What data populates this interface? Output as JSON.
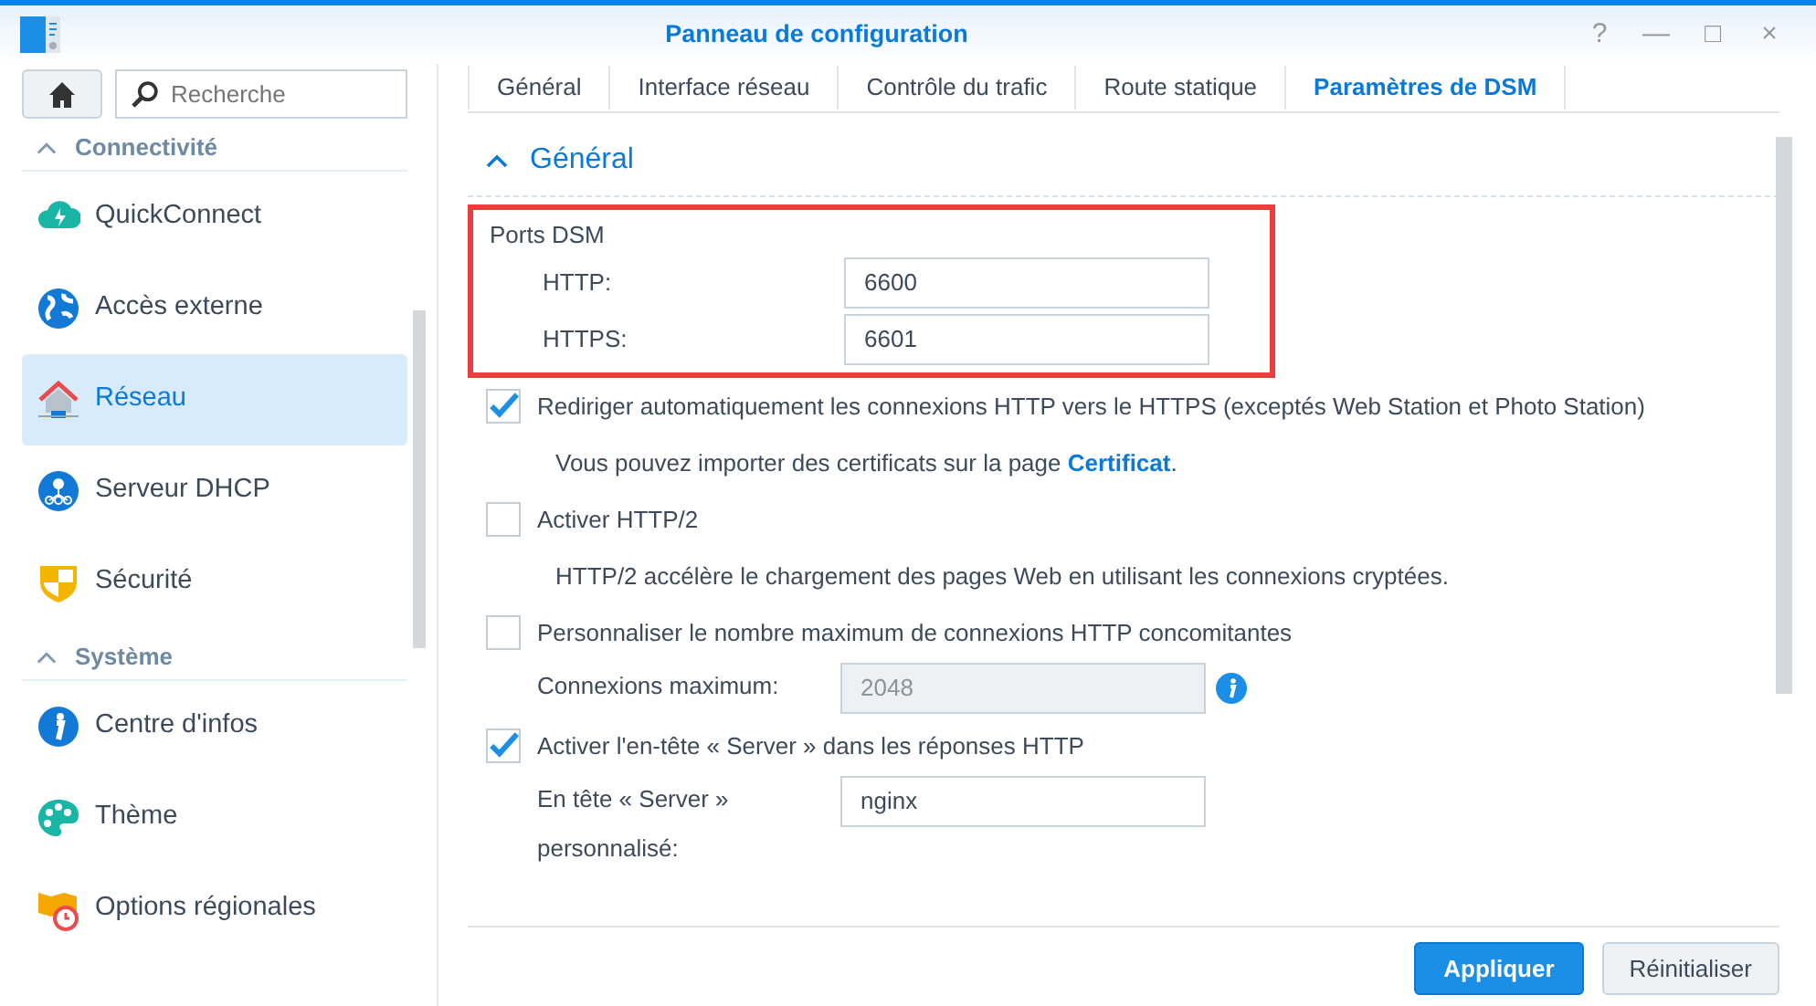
{
  "window": {
    "title": "Panneau de configuration",
    "controls": [
      "?",
      "—",
      "□",
      "×"
    ]
  },
  "sidebar": {
    "search": {
      "placeholder": "Recherche"
    },
    "sections": [
      {
        "title": "Connectivité",
        "expanded": true,
        "items": [
          {
            "label": "QuickConnect",
            "selected": false
          },
          {
            "label": "Accès externe",
            "selected": false
          },
          {
            "label": "Réseau",
            "selected": true
          },
          {
            "label": "Serveur DHCP",
            "selected": false
          },
          {
            "label": "Sécurité",
            "selected": false
          }
        ]
      },
      {
        "title": "Système",
        "expanded": true,
        "items": [
          {
            "label": "Centre d'infos",
            "selected": false
          },
          {
            "label": "Thème",
            "selected": false
          },
          {
            "label": "Options régionales",
            "selected": false
          }
        ]
      }
    ]
  },
  "tabs": [
    {
      "label": "Général",
      "selected": false
    },
    {
      "label": "Interface réseau",
      "selected": false
    },
    {
      "label": "Contrôle du trafic",
      "selected": false
    },
    {
      "label": "Route statique",
      "selected": false
    },
    {
      "label": "Paramètres de DSM",
      "selected": true
    }
  ],
  "section": {
    "title": "Général",
    "expanded": true,
    "ports": {
      "title": "Ports DSM",
      "highlighted": true,
      "fields": [
        {
          "label": "HTTP:",
          "value": "6600"
        },
        {
          "label": "HTTPS:",
          "value": "6601"
        }
      ]
    },
    "rows": [
      {
        "kind": "checkbox",
        "label": "Rediriger automatiquement les connexions HTTP vers le HTTPS (exceptés Web Station et Photo Station)",
        "checked": true
      },
      {
        "kind": "note",
        "text": "Vous pouvez importer des certificats sur la page ",
        "link": "Certificat",
        "after": "."
      },
      {
        "kind": "checkbox",
        "label": "Activer HTTP/2",
        "checked": false
      },
      {
        "kind": "note",
        "text": "HTTP/2 accélère le chargement des pages Web en utilisant les connexions cryptées."
      },
      {
        "kind": "checkbox",
        "label": "Personnaliser le nombre maximum de connexions HTTP concomitantes",
        "checked": false
      },
      {
        "kind": "field",
        "label": "Connexions maximum:",
        "value": "2048",
        "disabled": true,
        "info": true
      },
      {
        "kind": "checkbox",
        "label": "Activer l'en-tête « Server » dans les réponses HTTP",
        "checked": true
      },
      {
        "kind": "field",
        "label": "En tête « Server » personnalisé:",
        "value": "nginx",
        "disabled": false,
        "info": false
      }
    ]
  },
  "buttons": [
    {
      "label": "Appliquer",
      "kind": "primary"
    },
    {
      "label": "Réinitialiser",
      "kind": "secondary"
    }
  ]
}
